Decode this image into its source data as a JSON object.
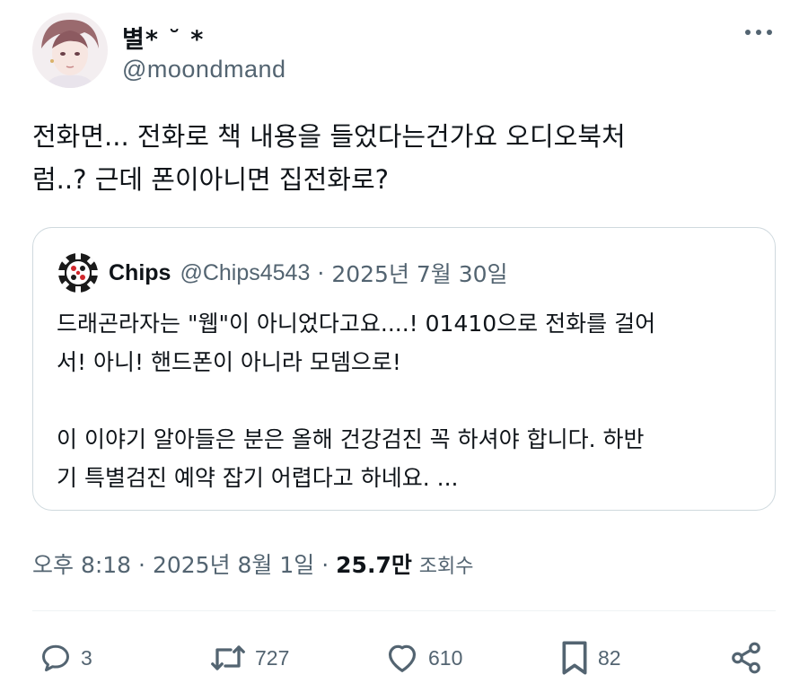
{
  "author": {
    "display_name": "별* ˘ *",
    "handle": "@moondmand",
    "avatar": "avatar-image"
  },
  "tweet": {
    "text_line1": "전화면... 전화로 책 내용을 들었다는건가요 오디오북처",
    "text_line2": "럼..? 근데 폰이아니면 집전화로?"
  },
  "quote": {
    "name": "Chips",
    "handle": "@Chips4543",
    "separator": "·",
    "date": "2025년 7월 30일",
    "avatar": "poker-chip-icon",
    "line1": "드래곤라자는 \"웹\"이 아니었다고요....! 01410으로 전화를 걸어",
    "line2": "서! 아니! 핸드폰이 아니라 모뎀으로!",
    "line3": "이 이야기 알아들은 분은 올해 건강검진 꼭 하셔야 합니다. 하반",
    "line4": "기 특별검진 예약 잡기 어렵다고 하네요. ..."
  },
  "meta": {
    "time": "오후 8:18",
    "date": "2025년 8월 1일",
    "separator": "·",
    "views": "25.7만",
    "views_label": "조회수"
  },
  "actions": {
    "reply": {
      "count": "3",
      "icon": "reply-icon"
    },
    "retweet": {
      "count": "727",
      "icon": "retweet-icon"
    },
    "like": {
      "count": "610",
      "icon": "heart-icon"
    },
    "bookmark": {
      "count": "82",
      "icon": "bookmark-icon"
    },
    "share": {
      "icon": "share-icon"
    }
  },
  "colors": {
    "text": "#0f1419",
    "secondary": "#536471",
    "border": "#cfd9de"
  }
}
